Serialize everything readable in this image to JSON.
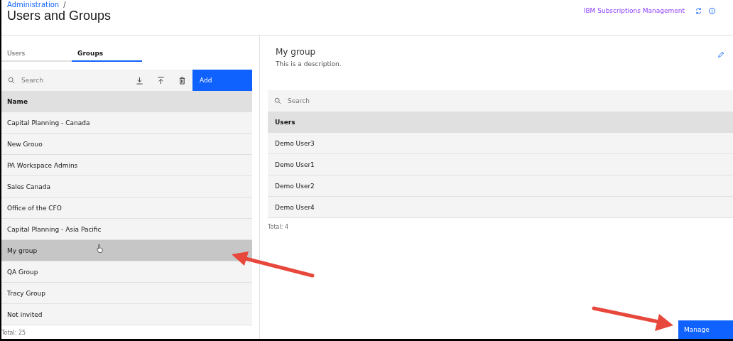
{
  "breadcrumb": "Administration",
  "breadcrumb_separator": "/",
  "title": "Users and Groups",
  "header_link": "IBM Subscriptions Management",
  "tabs": [
    {
      "label": "Users",
      "selected": false
    },
    {
      "label": "Groups",
      "selected": true
    }
  ],
  "groups": {
    "search": {
      "placeholder": "Search"
    },
    "add_button": "Add",
    "column": "Name",
    "rows": [
      {
        "name": "Capital Planning - Canada",
        "selected": false
      },
      {
        "name": "New Grouo",
        "selected": false
      },
      {
        "name": "PA Workspace Admins",
        "selected": false
      },
      {
        "name": "Sales Canada",
        "selected": false
      },
      {
        "name": "Office of the CFO",
        "selected": false
      },
      {
        "name": "Capital Planning - Asia Pacific",
        "selected": false
      },
      {
        "name": "My group",
        "selected": true
      },
      {
        "name": "QA Group",
        "selected": false
      },
      {
        "name": "Tracy Group",
        "selected": false
      },
      {
        "name": "Not invited",
        "selected": false
      }
    ],
    "total": "Total: 25"
  },
  "detail": {
    "title": "My group",
    "description": "This is a description.",
    "search": {
      "placeholder": "Search"
    },
    "column": "Users",
    "rows": [
      "Demo User3",
      "Demo User1",
      "Demo User2",
      "Demo User4"
    ],
    "total": "Total: 4",
    "manage_button": "Manage"
  }
}
